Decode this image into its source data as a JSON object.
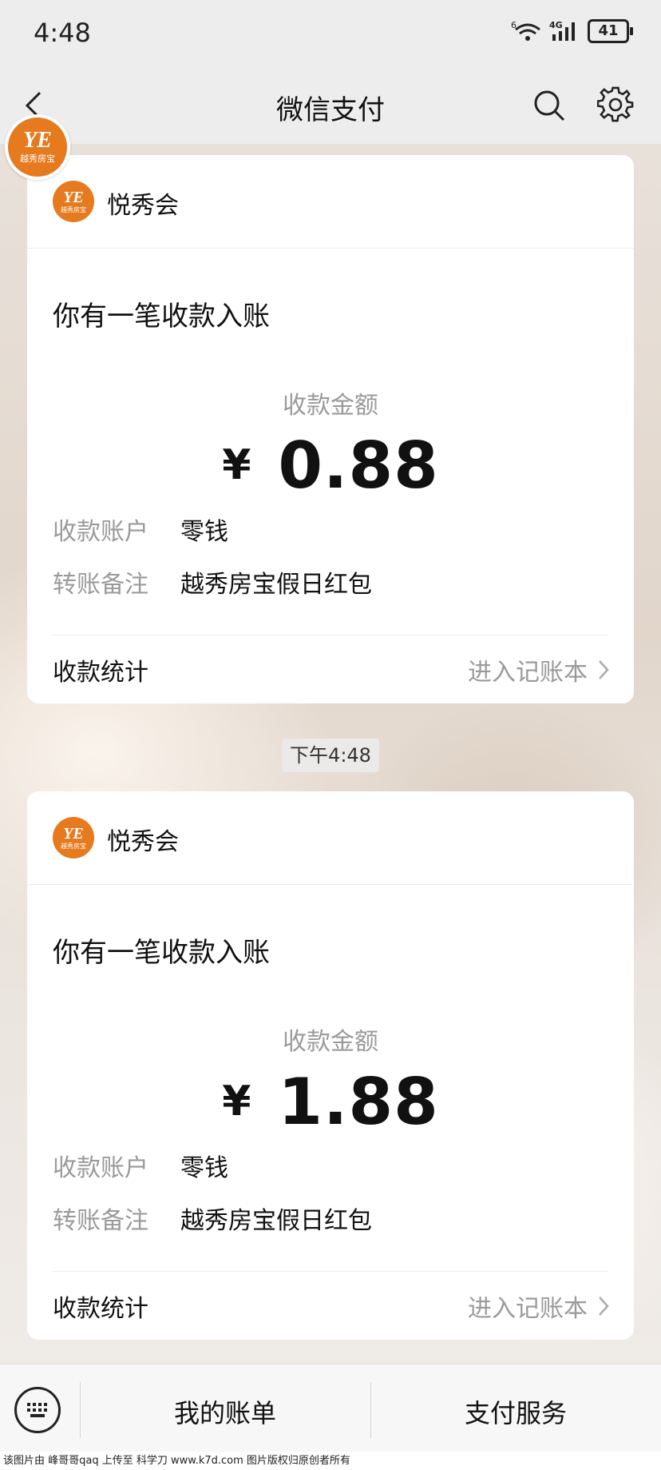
{
  "status_bar": {
    "time": "4:48",
    "signal_label": "4G",
    "wifi_label": "6",
    "battery": "41"
  },
  "nav": {
    "title": "微信支付"
  },
  "logo": {
    "text": "YE",
    "subtitle": "越秀房宝"
  },
  "cards": [
    {
      "merchant": "悦秀会",
      "title": "你有一笔收款入账",
      "amount_label": "收款金额",
      "currency": "¥",
      "amount": "0.88",
      "account_key": "收款账户",
      "account_value": "零钱",
      "note_key": "转账备注",
      "note_value": "越秀房宝假日红包",
      "stats_label": "收款统计",
      "stats_link": "进入记账本"
    },
    {
      "merchant": "悦秀会",
      "title": "你有一笔收款入账",
      "amount_label": "收款金额",
      "currency": "¥",
      "amount": "1.88",
      "account_key": "收款账户",
      "account_value": "零钱",
      "note_key": "转账备注",
      "note_value": "越秀房宝假日红包",
      "stats_label": "收款统计",
      "stats_link": "进入记账本"
    }
  ],
  "time_stamp": "下午4:48",
  "bottom_menu": {
    "bill": "我的账单",
    "service": "支付服务"
  },
  "watermark": "该图片由 峰哥哥qaq 上传至 科学刀 www.k7d.com 图片版权归原创者所有",
  "colors": {
    "brand_orange": "#e67a1e",
    "bg_gray": "#ededed",
    "muted_text": "#9a9a9a"
  }
}
